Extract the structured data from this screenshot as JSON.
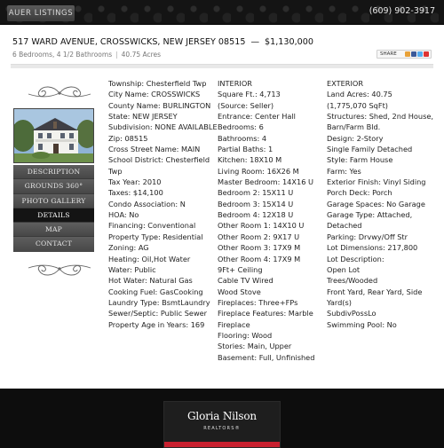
{
  "header": {
    "logo_text": "AUER LISTINGS",
    "phone": "(609) 902-3917"
  },
  "listing": {
    "address": "517 WARD AVENUE, CROSSWICKS, NEW JERSEY 08515",
    "dash": "—",
    "price": "$1,130,000",
    "beds_baths": "6 Bedrooms, 4 1/2 Bathrooms",
    "separator": "|",
    "acres": "40.75 Acres",
    "share_label": "SHARE"
  },
  "nav": {
    "items": [
      {
        "label": "DESCRIPTION",
        "active": false
      },
      {
        "label": "GROUNDS 360°",
        "active": false
      },
      {
        "label": "PHOTO GALLERY",
        "active": false
      },
      {
        "label": "DETAILS",
        "active": true
      },
      {
        "label": "MAP",
        "active": false
      },
      {
        "label": "CONTACT",
        "active": false
      }
    ]
  },
  "details": {
    "col1": [
      "Township: Chesterfield Twp",
      "City Name: CROSSWICKS",
      "County Name: BURLINGTON",
      "State: NEW JERSEY",
      "Subdivision: NONE AVAILABLE",
      "Zip: 08515",
      "Cross Street Name: MAIN",
      "School District: Chesterfield",
      "Twp",
      "Tax Year: 2010",
      "Taxes: $14,100",
      "Condo Association: N",
      "HOA: No",
      "Financing: Conventional",
      "Property Type: Residential",
      "Zoning: AG",
      "Heating: Oil,Hot Water",
      "Water: Public",
      "Hot Water: Natural Gas",
      "Cooking Fuel: GasCooking",
      "Laundry Type: BsmtLaundry",
      "Sewer/Septic: Public Sewer",
      "Property Age in Years: 169"
    ],
    "col2": [
      "INTERIOR",
      "Square Ft.: 4,713",
      "(Source: Seller)",
      "Entrance: Center Hall",
      "Bedrooms: 6",
      "Bathrooms: 4",
      "Partial Baths: 1",
      "Kitchen: 18X10 M",
      "Living Room: 16X26 M",
      "Master Bedroom: 14X16 U",
      "Bedroom 2: 15X11 U",
      "Bedroom 3: 15X14 U",
      "Bedroom 4: 12X18 U",
      "Other Room 1: 14X10 U",
      "Other Room 2: 9X17 U",
      "Other Room 3: 17X9 M",
      "Other Room 4: 17X9 M",
      "9Ft+ Ceiling",
      "Cable TV Wired",
      "Wood Stove",
      "Fireplaces: Three+FPs",
      "Fireplace Features: Marble",
      "Fireplace",
      "Flooring: Wood",
      "Stories: Main, Upper",
      "Basement: Full, Unfinished"
    ],
    "col3": [
      "EXTERIOR",
      "Land Acres: 40.75",
      "(1,775,070 SqFt)",
      "Structures: Shed, 2nd House,",
      "Barn/Farm Bld.",
      "Design: 2-Story",
      "Single Family Detached",
      "Style: Farm House",
      "Farm: Yes",
      "Exterior Finish: Vinyl Siding",
      "Porch Deck: Porch",
      "Garage Spaces: No Garage",
      "Garage Type: Attached,",
      "Detached",
      "Parking: Drvwy/Off Str",
      "Lot Dimensions: 217,800",
      "Lot Description:",
      "Open Lot",
      "Trees/Wooded",
      "Front Yard, Rear Yard, Side",
      "Yard(s)",
      "SubdivPossLo",
      "Swimming Pool: No"
    ]
  },
  "footer": {
    "brand_name": "Gloria Nilson",
    "brand_sub": "REALTORS®"
  },
  "colors": {
    "header_bg": "#141414",
    "nav_bg": "#4a4a4a",
    "nav_active": "#141414",
    "footer_bg": "#0d0d0d",
    "brand_red": "#c8202f"
  },
  "icons": [
    "ornament-flourish",
    "share-icons"
  ]
}
